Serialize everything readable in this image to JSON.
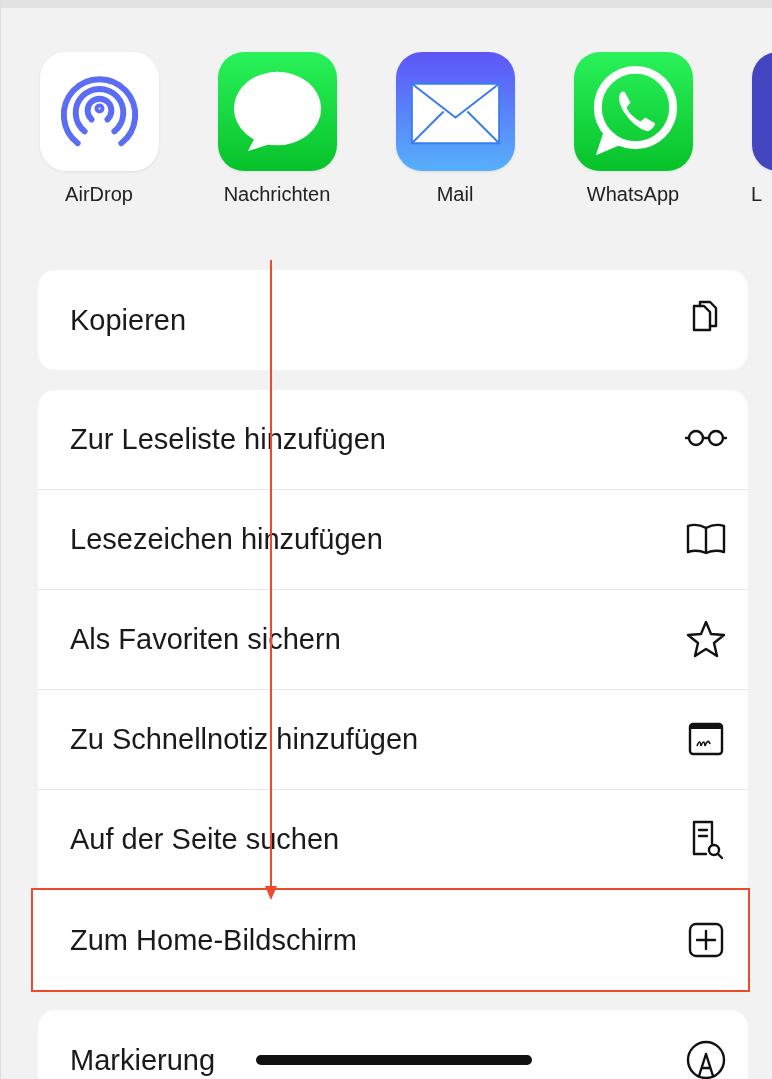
{
  "apps": [
    {
      "label": "AirDrop"
    },
    {
      "label": "Nachrichten"
    },
    {
      "label": "Mail"
    },
    {
      "label": "WhatsApp"
    },
    {
      "label": "L"
    }
  ],
  "action_groups": [
    {
      "rows": [
        {
          "label": "Kopieren",
          "highlighted": false
        }
      ]
    },
    {
      "rows": [
        {
          "label": "Zur Leseliste hinzufügen",
          "highlighted": false
        },
        {
          "label": "Lesezeichen hinzufügen",
          "highlighted": false
        },
        {
          "label": "Als Favoriten sichern",
          "highlighted": false
        },
        {
          "label": "Zu Schnellnotiz hinzufügen",
          "highlighted": false
        },
        {
          "label": "Auf der Seite suchen",
          "highlighted": false
        },
        {
          "label": "Zum Home-Bildschirm",
          "highlighted": true
        }
      ]
    },
    {
      "rows": [
        {
          "label": "Markierung",
          "highlighted": false
        }
      ]
    }
  ],
  "annotation": {
    "arrow": true
  }
}
